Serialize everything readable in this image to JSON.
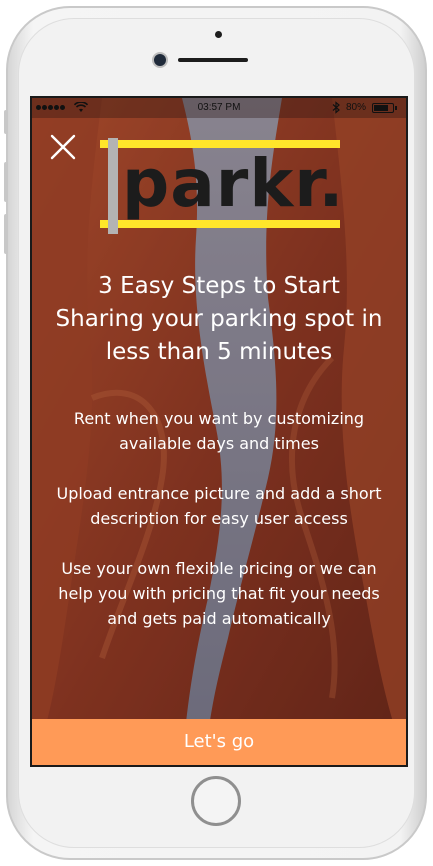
{
  "status_bar": {
    "time": "03:57 PM",
    "battery": "80%"
  },
  "logo_text": "parkr.",
  "headline": {
    "line1": "3 Easy Steps to Start",
    "line2": "Sharing your parking spot in",
    "line3": "less than 5 minutes"
  },
  "steps": [
    {
      "line1": "Rent when you want by customizing",
      "line2": "available days and times"
    },
    {
      "line1": "Upload entrance picture and add a short",
      "line2": "description for easy user access"
    },
    {
      "line1": "Use your own flexible pricing or we can",
      "line2": "help you with pricing that fit your needs",
      "line3": "and gets paid automatically"
    }
  ],
  "cta_label": "Let's go",
  "colors": {
    "accent": "#ff9a57",
    "logo_bar": "#ffe62a",
    "overlay": "#5a2a20"
  }
}
